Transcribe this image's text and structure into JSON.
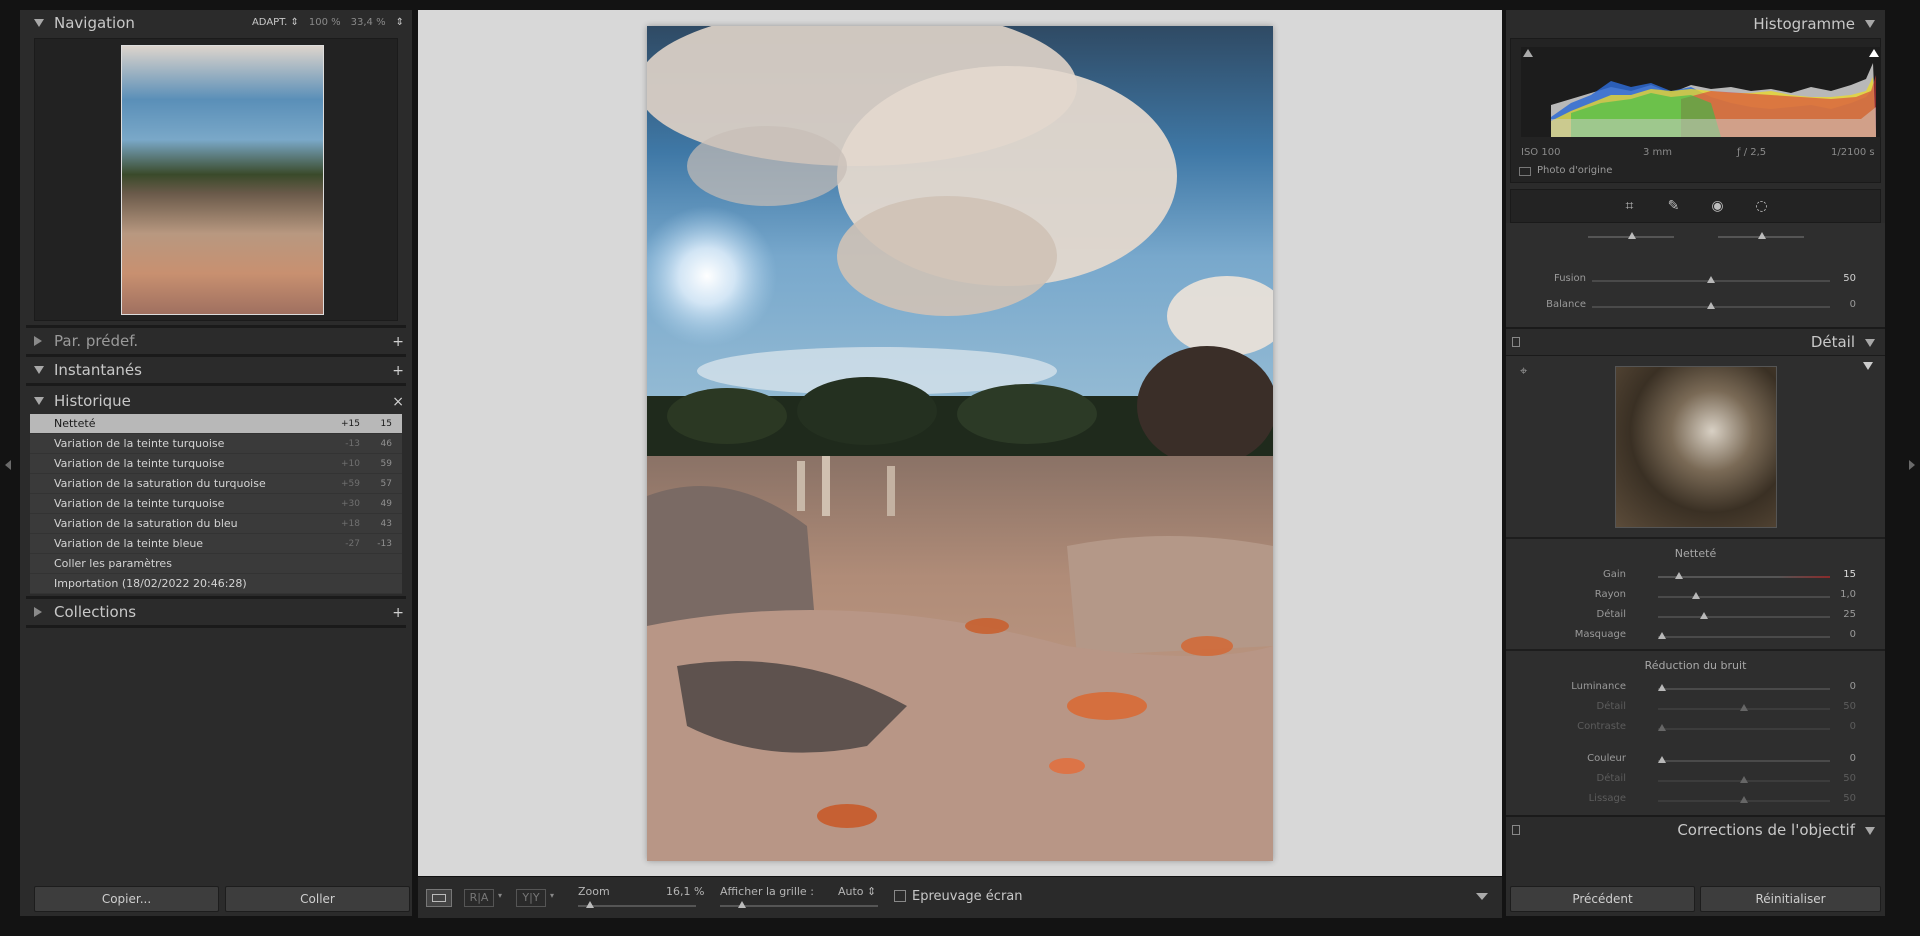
{
  "navigation": {
    "title": "Navigation",
    "zoom_fit": "ADAPT. ⇕",
    "zoom_100": "100 %",
    "zoom_custom": "33,4 %"
  },
  "presets": {
    "title": "Par. prédef.",
    "action": "+"
  },
  "snapshots": {
    "title": "Instantanés",
    "action": "+"
  },
  "history": {
    "title": "Historique",
    "action": "×",
    "items": [
      {
        "label": "Netteté",
        "v1": "+15",
        "v2": "15"
      },
      {
        "label": "Variation de la teinte turquoise",
        "v1": "-13",
        "v2": "46"
      },
      {
        "label": "Variation de la teinte turquoise",
        "v1": "+10",
        "v2": "59"
      },
      {
        "label": "Variation de la saturation du turquoise",
        "v1": "+59",
        "v2": "57"
      },
      {
        "label": "Variation de la teinte turquoise",
        "v1": "+30",
        "v2": "49"
      },
      {
        "label": "Variation de la saturation du bleu",
        "v1": "+18",
        "v2": "43"
      },
      {
        "label": "Variation de la teinte bleue",
        "v1": "-27",
        "v2": "-13"
      },
      {
        "label": "Coller les paramètres",
        "v1": "",
        "v2": ""
      },
      {
        "label": "Importation (18/02/2022 20:46:28)",
        "v1": "",
        "v2": ""
      }
    ]
  },
  "collections": {
    "title": "Collections",
    "action": "+"
  },
  "left_buttons": {
    "copy": "Copier...",
    "paste": "Coller"
  },
  "toolbar": {
    "zoom_label": "Zoom",
    "zoom_value": "16,1 %",
    "grid_label": "Afficher la grille :",
    "grid_value": "Auto ⇕",
    "softproof": "Epreuvage écran",
    "view_ra": "R|A",
    "view_yy": "Y|Y"
  },
  "histogram": {
    "title": "Histogramme",
    "iso": "ISO 100",
    "focal": "3 mm",
    "aperture": "ƒ / 2,5",
    "shutter": "1/2100 s",
    "original": "Photo d'origine"
  },
  "tone_sliders": [
    {
      "label": "Fusion",
      "value": "50",
      "pos": 0.5
    },
    {
      "label": "Balance",
      "value": "0",
      "pos": 0.5
    }
  ],
  "detail": {
    "title": "Détail",
    "sharpening_title": "Netteté",
    "sharpening": [
      {
        "label": "Gain",
        "value": "15",
        "pos": 0.1
      },
      {
        "label": "Rayon",
        "value": "1,0",
        "pos": 0.22
      },
      {
        "label": "Détail",
        "value": "25",
        "pos": 0.27
      },
      {
        "label": "Masquage",
        "value": "0",
        "pos": 0.0
      }
    ],
    "noise_title": "Réduction du bruit",
    "noise": [
      {
        "label": "Luminance",
        "value": "0",
        "pos": 0.0,
        "dim": false
      },
      {
        "label": "Détail",
        "value": "50",
        "pos": 0.5,
        "dim": true
      },
      {
        "label": "Contraste",
        "value": "0",
        "pos": 0.0,
        "dim": true
      },
      {
        "label": "Couleur",
        "value": "0",
        "pos": 0.0,
        "dim": false
      },
      {
        "label": "Détail",
        "value": "50",
        "pos": 0.5,
        "dim": true
      },
      {
        "label": "Lissage",
        "value": "50",
        "pos": 0.5,
        "dim": true
      }
    ]
  },
  "lens": {
    "title": "Corrections de l'objectif"
  },
  "right_buttons": {
    "previous": "Précédent",
    "reset": "Réinitialiser"
  }
}
